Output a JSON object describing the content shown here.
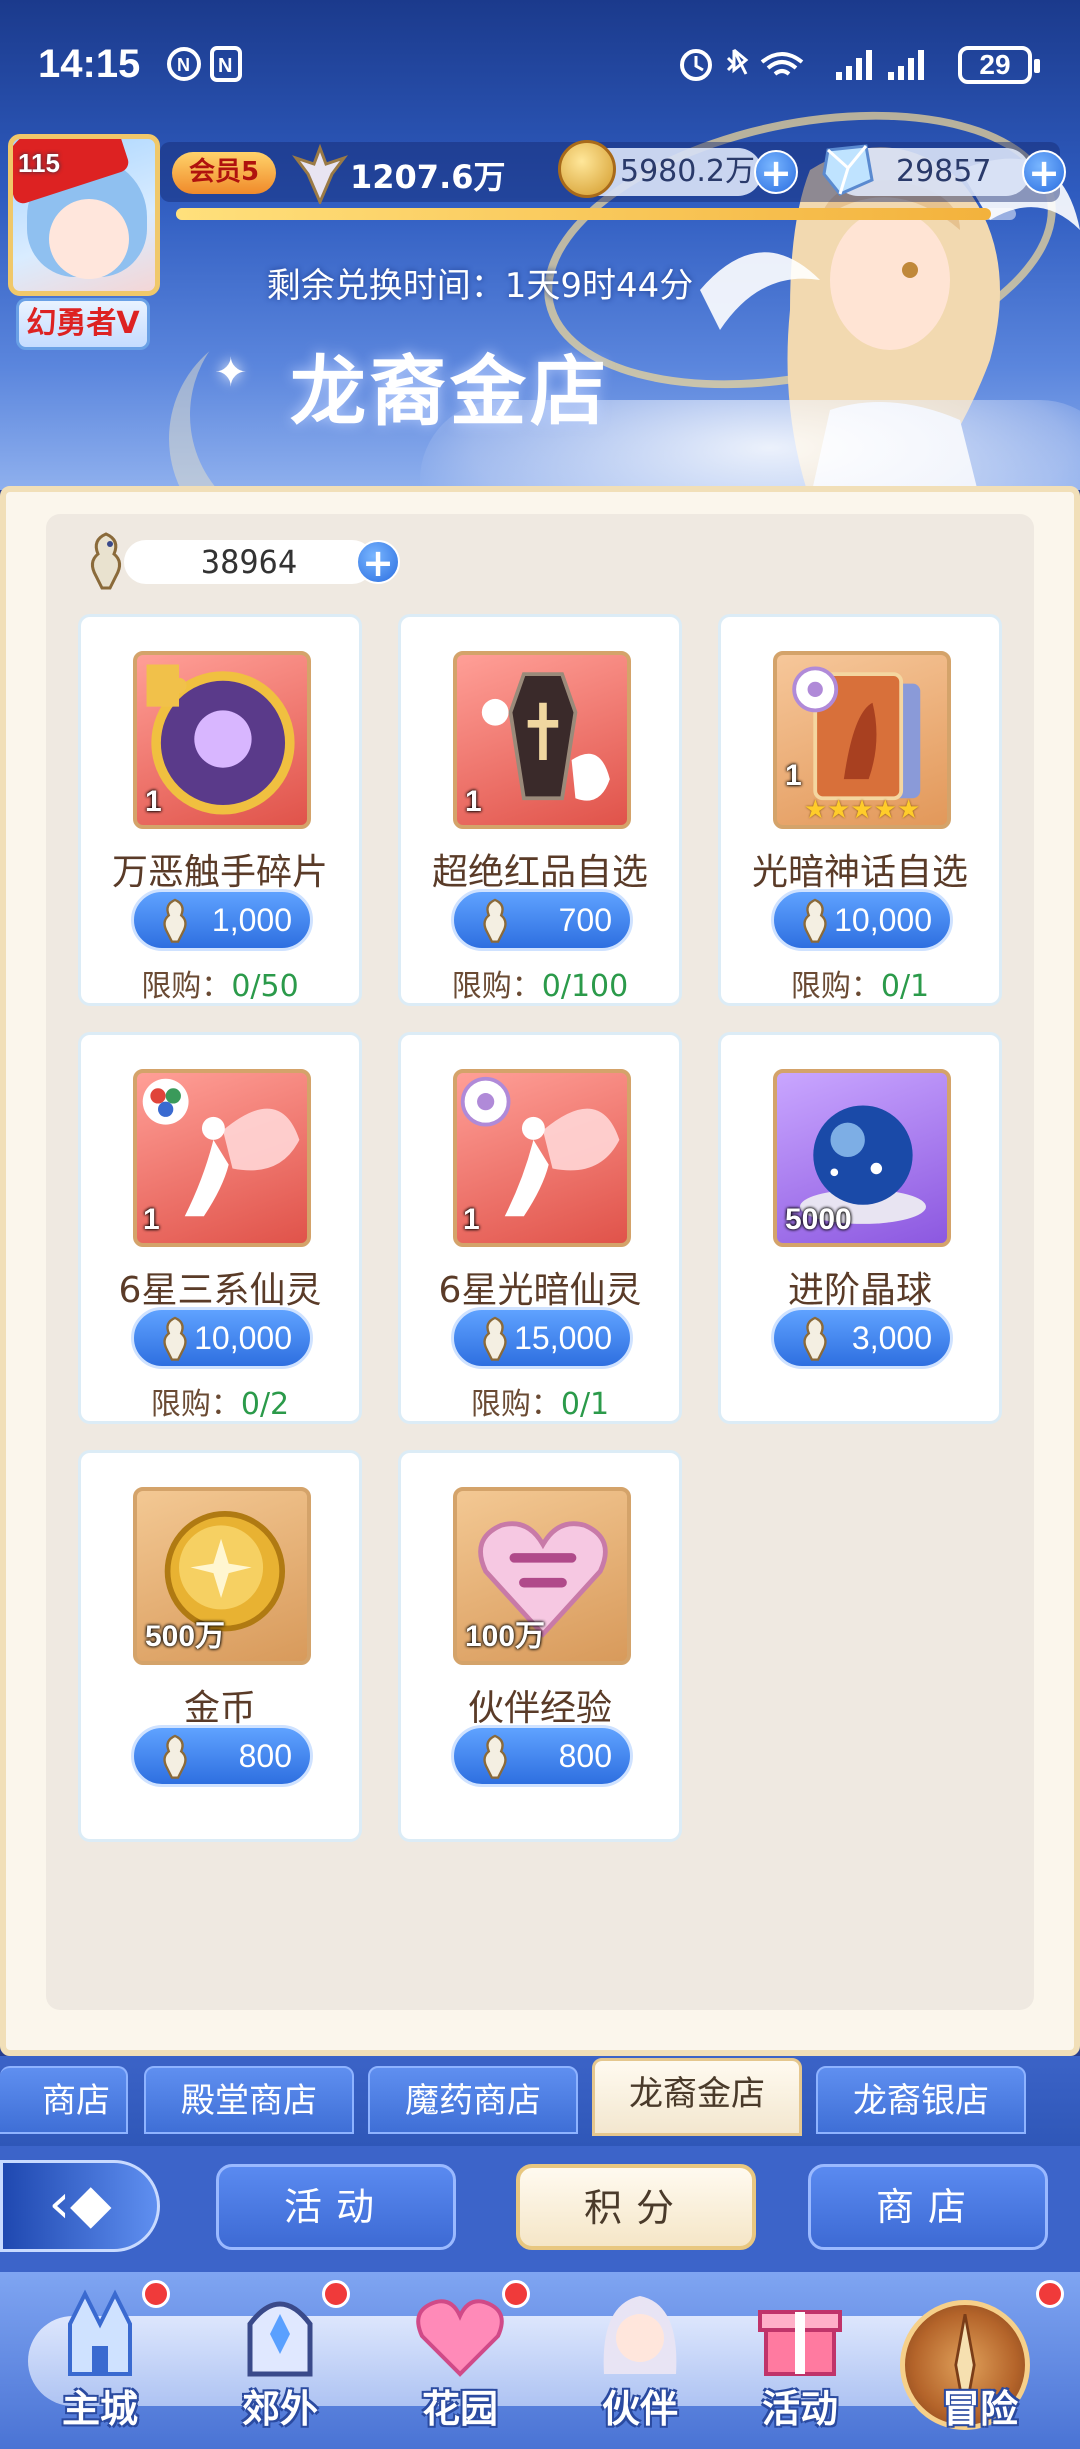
{
  "status_bar": {
    "time": "14:15",
    "battery": "29"
  },
  "player": {
    "level": "115",
    "title": "幻勇者V",
    "vip": "会员5",
    "power": "1207.6万",
    "gold": "5980.2万",
    "diamond": "29857",
    "progress": 0.97
  },
  "banner": {
    "exchange_time": "剩余兑换时间：1天9时44分",
    "title": "龙裔金店"
  },
  "shop": {
    "currency_amount": "38964",
    "items": [
      {
        "name": "万恶触手碎片",
        "qty": "1",
        "price": "1,000",
        "limit_label": "限购：",
        "limit_value": "0/50"
      },
      {
        "name": "超绝红品自选",
        "qty": "1",
        "price": "700",
        "limit_label": "限购：",
        "limit_value": "0/100"
      },
      {
        "name": "光暗神话自选",
        "qty": "1",
        "price": "10,000",
        "limit_label": "限购：",
        "limit_value": "0/1",
        "stars": 5
      },
      {
        "name": "6星三系仙灵",
        "qty": "1",
        "price": "10,000",
        "limit_label": "限购：",
        "limit_value": "0/2"
      },
      {
        "name": "6星光暗仙灵",
        "qty": "1",
        "price": "15,000",
        "limit_label": "限购：",
        "limit_value": "0/1"
      },
      {
        "name": "进阶晶球",
        "qty": "5000",
        "price": "3,000"
      },
      {
        "name": "金币",
        "qty": "500万",
        "price": "800"
      },
      {
        "name": "伙伴经验",
        "qty": "100万",
        "price": "800"
      }
    ]
  },
  "shop_tabs": [
    "商店",
    "殿堂商店",
    "魔药商店",
    "龙裔金店",
    "龙裔银店"
  ],
  "category_tabs": {
    "back_icon": "back-arrow-icon",
    "activity": "活动",
    "points": "积分",
    "store": "商店"
  },
  "nav": [
    "主城",
    "郊外",
    "花园",
    "伙伴",
    "活动",
    "冒险"
  ],
  "colors": {
    "accent_blue": "#2e6fe0",
    "limit_green": "#2b9a4a",
    "panel_bg": "#efe9e1"
  }
}
